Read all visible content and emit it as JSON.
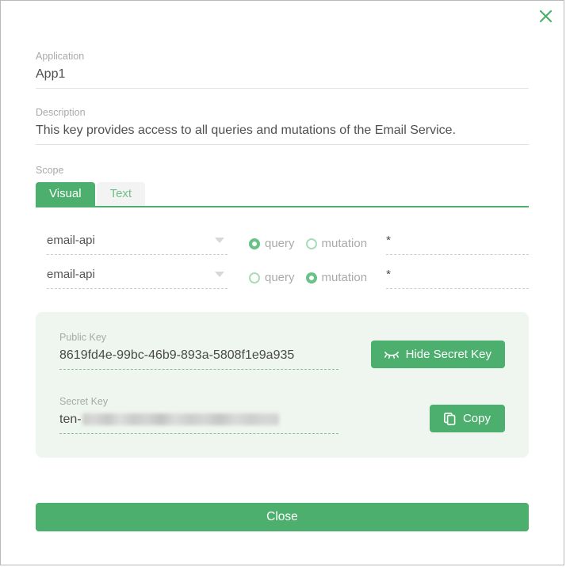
{
  "dialog": {
    "close_icon": "close-x-icon"
  },
  "application": {
    "label": "Application",
    "value": "App1"
  },
  "description": {
    "label": "Description",
    "value": "This key provides access to all queries and mutations of the Email Service."
  },
  "scope": {
    "label": "Scope",
    "tabs": [
      {
        "label": "Visual",
        "active": true
      },
      {
        "label": "Text",
        "active": false
      }
    ],
    "rows": [
      {
        "service": "email-api",
        "dropdown_icon": "chevron-down-icon",
        "options": [
          {
            "label": "query",
            "selected": true
          },
          {
            "label": "mutation",
            "selected": false
          }
        ],
        "pattern": "*"
      },
      {
        "service": "email-api",
        "dropdown_icon": "chevron-down-icon",
        "options": [
          {
            "label": "query",
            "selected": false
          },
          {
            "label": "mutation",
            "selected": true
          }
        ],
        "pattern": "*"
      }
    ]
  },
  "keys": {
    "public": {
      "label": "Public Key",
      "value": "8619fd4e-99bc-46b9-893a-5808f1e9a935"
    },
    "secret": {
      "label": "Secret Key",
      "prefix": "ten-",
      "masked": true
    },
    "hide_button": {
      "label": "Hide Secret Key",
      "icon": "eye-slash-icon"
    },
    "copy_button": {
      "label": "Copy",
      "icon": "copy-icon"
    }
  },
  "footer": {
    "close_label": "Close"
  },
  "colors": {
    "accent": "#4caf6d",
    "panel_bg": "#eef6ef",
    "label_gray": "#a9a9a9",
    "value_gray": "#505050"
  }
}
